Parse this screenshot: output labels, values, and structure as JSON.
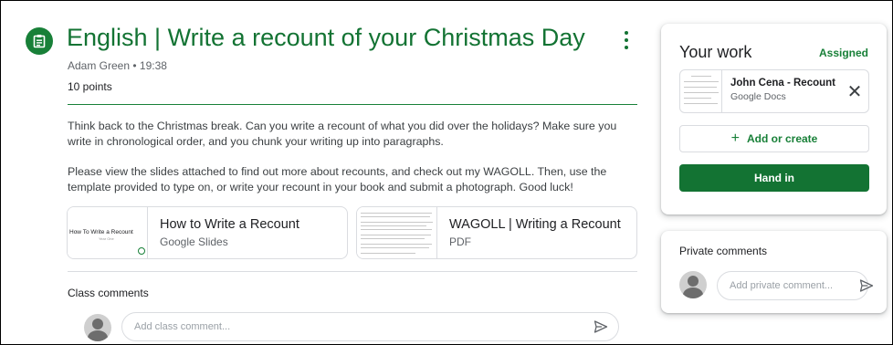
{
  "assignment": {
    "title": "English | Write a recount of your Christmas Day",
    "meta": "Adam Green • 19:38",
    "points": "10 points",
    "description_1": "Think back to the Christmas break. Can you write a recount of what you did over the holidays? Make sure you write in chronological order, and you chunk your writing up into paragraphs.",
    "description_2": "Please view the slides attached to find out more about recounts, and check out my WAGOLL. Then, use the template provided to type on, or write your recount in your book and submit a photograph. Good luck!",
    "attachments": [
      {
        "title": "How to Write a Recount",
        "type": "Google Slides",
        "thumb_text": "How To Write a Recount",
        "thumb_sub": "Year One",
        "icon": "slides-thumbnail"
      },
      {
        "title": "WAGOLL | Writing a Recount",
        "type": "PDF",
        "icon": "pdf-thumbnail"
      }
    ]
  },
  "class_comments": {
    "label": "Class comments",
    "placeholder": "Add class comment..."
  },
  "your_work": {
    "title": "Your work",
    "status": "Assigned",
    "status_color": "#188038",
    "file": {
      "name": "John Cena - Recount",
      "type": "Google Docs"
    },
    "add_label": "Add or create",
    "hand_in_label": "Hand in"
  },
  "private_comments": {
    "label": "Private comments",
    "placeholder": "Add private comment..."
  },
  "colors": {
    "accent": "#137333",
    "accent_light": "#188038",
    "border": "#dadce0"
  }
}
